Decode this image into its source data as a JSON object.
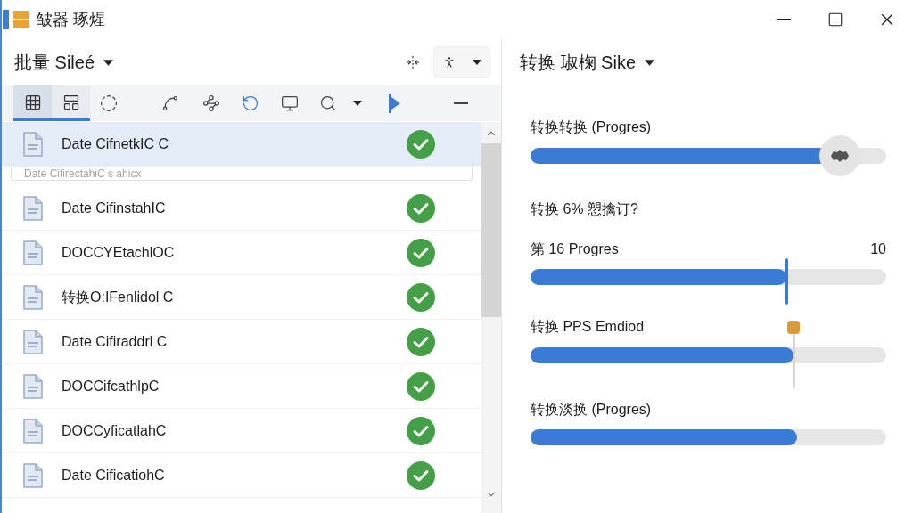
{
  "window": {
    "title": "皱器 琢煋"
  },
  "left_pane": {
    "header": {
      "title": "批量 Sileé"
    },
    "view_toggle": [
      {
        "selected": true
      },
      {
        "selected": false
      }
    ],
    "rows": [
      {
        "name": "Date CifnetkIC C",
        "selected": true,
        "done": true
      },
      {
        "name": "Date CifinstahIC",
        "selected": false,
        "done": true
      },
      {
        "name": "DOCCYEtachlOC",
        "selected": false,
        "done": true
      },
      {
        "name": "转换O:IFenlidol C",
        "selected": false,
        "done": true
      },
      {
        "name": "Date Cifiraddrl C",
        "selected": false,
        "done": true
      },
      {
        "name": "DOCCifcathlpC",
        "selected": false,
        "done": true
      },
      {
        "name": "DOCCyficatlahC",
        "selected": false,
        "done": true
      },
      {
        "name": "Date CificatiohC",
        "selected": false,
        "done": true
      }
    ],
    "drag_preview": {
      "label": "Date CifirectahiC s ahicx"
    }
  },
  "right_pane": {
    "header": {
      "title": "转换 琡椈 Sike"
    },
    "items": [
      {
        "kind": "slider",
        "thumb": {
          "kind": "round"
        },
        "label": "转换转换 (Progres)",
        "level": 0.87
      },
      {
        "kind": "heading",
        "label": "转换 6% 愬擒订?"
      },
      {
        "kind": "slider",
        "thumb": {
          "kind": "line"
        },
        "label": "第 16 Progres",
        "reading": "10",
        "level": 0.72
      },
      {
        "kind": "slider",
        "thumb": {
          "kind": "marker"
        },
        "label": "转换 PPS Emdiod",
        "level": 0.74
      },
      {
        "kind": "progress",
        "label": "转换淡换 (Progres)",
        "level": 0.75
      }
    ]
  }
}
